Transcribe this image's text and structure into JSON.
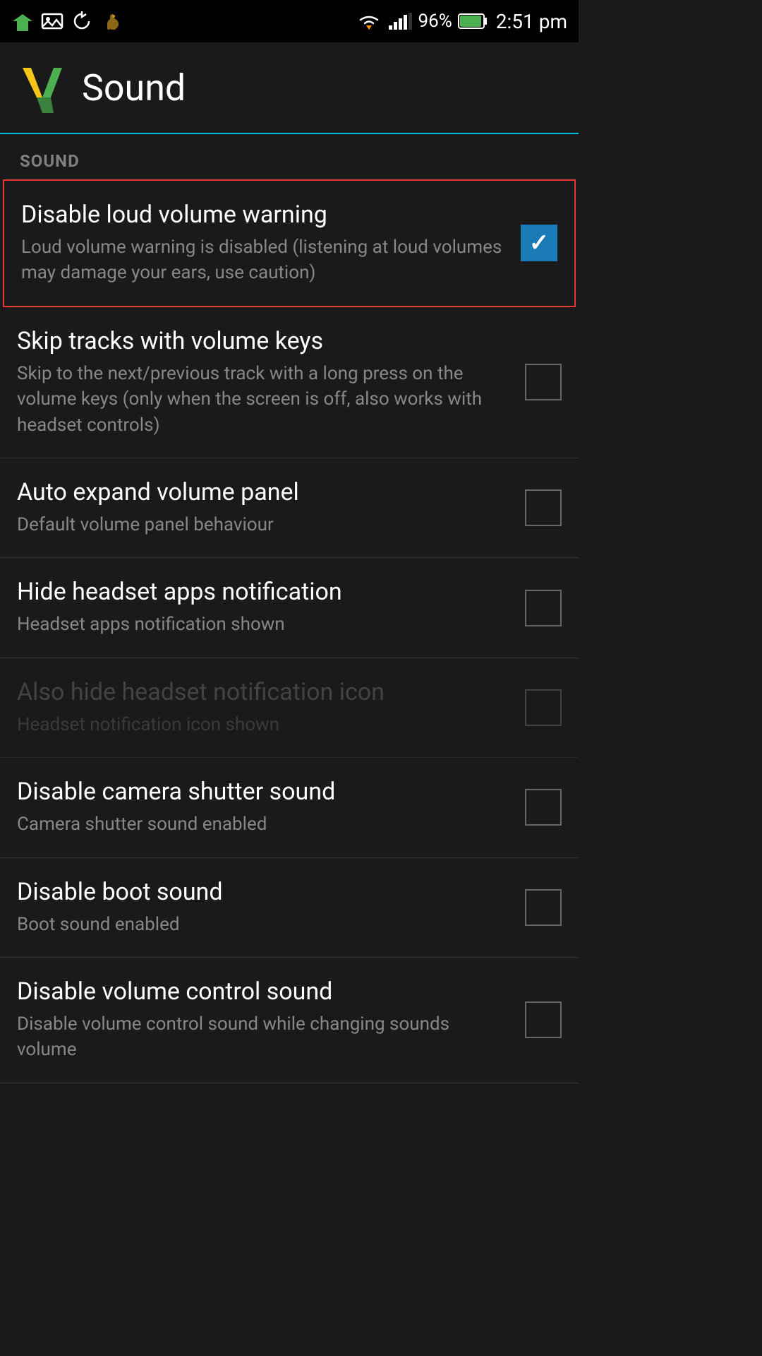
{
  "statusBar": {
    "time": "2:51 pm",
    "battery": "96%",
    "icons": [
      "wifi",
      "signal",
      "battery"
    ]
  },
  "header": {
    "title": "Sound",
    "logo_alt": "App logo"
  },
  "section": {
    "label": "SOUND"
  },
  "settings": [
    {
      "id": "disable-loud-volume-warning",
      "title": "Disable loud volume warning",
      "subtitle": "Loud volume warning is disabled (listening at loud volumes may damage your ears, use caution)",
      "checked": true,
      "highlighted": true,
      "dimmed": false
    },
    {
      "id": "skip-tracks-volume-keys",
      "title": "Skip tracks with volume keys",
      "subtitle": "Skip to the next/previous track with a long press on the volume keys (only when the screen is off, also works with headset controls)",
      "checked": false,
      "highlighted": false,
      "dimmed": false
    },
    {
      "id": "auto-expand-volume-panel",
      "title": "Auto expand volume panel",
      "subtitle": "Default volume panel behaviour",
      "checked": false,
      "highlighted": false,
      "dimmed": false
    },
    {
      "id": "hide-headset-apps-notification",
      "title": "Hide headset apps notification",
      "subtitle": "Headset apps notification shown",
      "checked": false,
      "highlighted": false,
      "dimmed": false
    },
    {
      "id": "also-hide-headset-notification-icon",
      "title": "Also hide headset notification icon",
      "subtitle": "Headset notification icon shown",
      "checked": false,
      "highlighted": false,
      "dimmed": true
    },
    {
      "id": "disable-camera-shutter-sound",
      "title": "Disable camera shutter sound",
      "subtitle": "Camera shutter sound enabled",
      "checked": false,
      "highlighted": false,
      "dimmed": false
    },
    {
      "id": "disable-boot-sound",
      "title": "Disable boot sound",
      "subtitle": "Boot sound enabled",
      "checked": false,
      "highlighted": false,
      "dimmed": false
    },
    {
      "id": "disable-volume-control-sound",
      "title": "Disable volume control sound",
      "subtitle": "Disable volume control sound while changing sounds volume",
      "checked": false,
      "highlighted": false,
      "dimmed": false
    }
  ]
}
